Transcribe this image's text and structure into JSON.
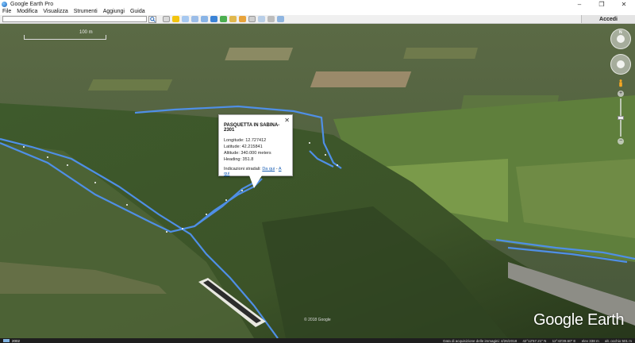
{
  "window": {
    "title": "Google Earth Pro",
    "min": "–",
    "max": "❐",
    "close": "✕"
  },
  "menu": {
    "items": [
      "File",
      "Modifica",
      "Visualizza",
      "Strumenti",
      "Aggiungi",
      "Guida"
    ]
  },
  "toolbar": {
    "search_value": "",
    "signin_label": "Accedi"
  },
  "colors": {
    "track": "#4f8fe6",
    "accent": "#1a5fb4"
  },
  "popup": {
    "title": "PASQUETTA IN SABINA-2301",
    "close": "✕",
    "longitude": "Longitude: 12.727412",
    "latitude": "Latitude: 42.215841",
    "altitude": "Altitude: 340.000 meters",
    "heading": "Heading: 351.8",
    "directions_label": "Indicazioni stradali:",
    "directions_from": "Da qui",
    "directions_sep": "-",
    "directions_to": "A qui"
  },
  "map": {
    "scale_label": "100 m",
    "copyright": "© 2018 Google",
    "brand": "Google Earth"
  },
  "nav": {
    "north": "N",
    "zoom_in": "+",
    "zoom_out": "−"
  },
  "status": {
    "year": "2002",
    "imagery_date": "Data di acquisizione delle immagini: 4/26/2018",
    "lat": "42°12'57.21\" N",
    "lon": "12°43'39.60\" E",
    "elev": "elev 338 m",
    "eye": "alt. occhio 501 m"
  }
}
